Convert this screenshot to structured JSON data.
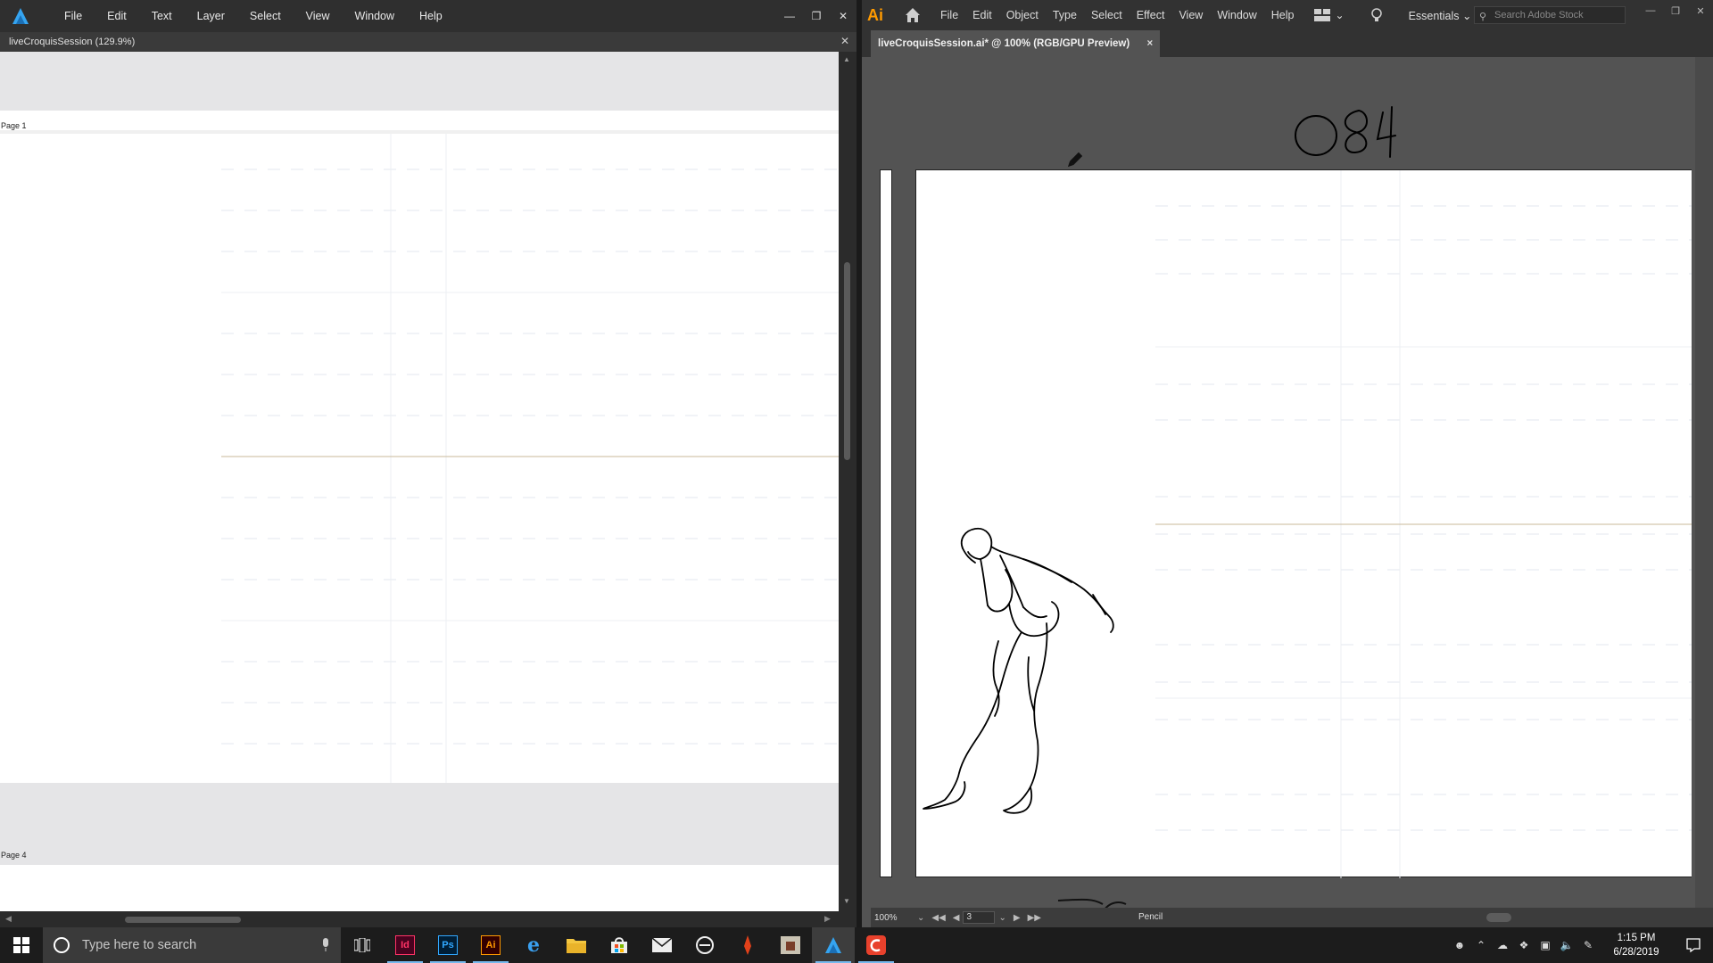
{
  "publisher": {
    "menu": [
      "File",
      "Edit",
      "Text",
      "Layer",
      "Select",
      "View",
      "Window",
      "Help"
    ],
    "doc_title": "liveCroquisSession (129.9%)",
    "page_labels": [
      "Page 1",
      "Page 4"
    ]
  },
  "illustrator": {
    "logo": "Ai",
    "menu": [
      "File",
      "Edit",
      "Object",
      "Type",
      "Select",
      "Effect",
      "View",
      "Window",
      "Help"
    ],
    "workspace": "Essentials",
    "stock_placeholder": "Search Adobe Stock",
    "tab_title": "liveCroquisSession.ai* @ 100% (RGB/GPU Preview)",
    "handwritten_note": "0 84",
    "status": {
      "zoom": "100%",
      "page": "3",
      "tool": "Pencil"
    }
  },
  "taskbar": {
    "search_placeholder": "Type here to search",
    "apps": [
      {
        "name": "indesign-icon",
        "label": "Id",
        "color": "#ff3366"
      },
      {
        "name": "photoshop-icon",
        "label": "Ps",
        "color": "#31a8ff"
      },
      {
        "name": "illustrator-icon",
        "label": "Ai",
        "color": "#ff9a00"
      }
    ],
    "time": "1:15 PM",
    "date": "6/28/2019"
  },
  "colors": {
    "affinity_blue": "#35a4f0",
    "ai_orange": "#ff9a00",
    "guide_tan": "#c8b89a"
  }
}
